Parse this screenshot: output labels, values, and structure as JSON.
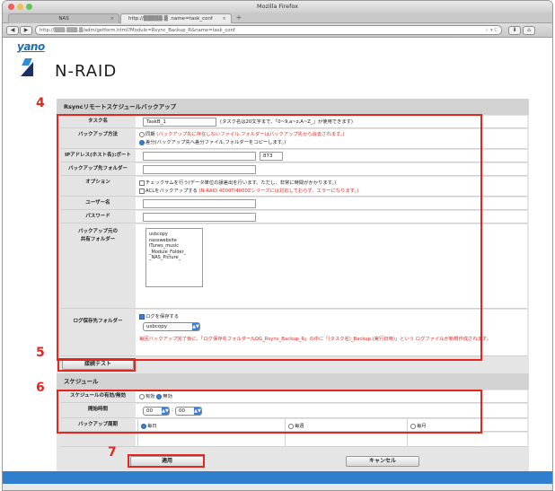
{
  "browser": {
    "window_title": "Mozilla Firefox",
    "tabs": [
      {
        "label": "NAS",
        "close": "×"
      },
      {
        "label": "http://▒▒▒▒▒.▒ .name=task_conf",
        "close": "×"
      }
    ],
    "new_tab": "+",
    "back": "◀",
    "forward": "▶",
    "url": "http://▒▒▒.▒▒▒.▒/adm/getform.html?Module=Rsync_Backup_R&name=task_conf",
    "url_right": "☆ ▾ C",
    "btn_download": "⬇",
    "btn_home": "⌂"
  },
  "logo": {
    "brand": "yano",
    "product": "N-RAID"
  },
  "section1": {
    "title": "Rsyncリモートスケジュールバックアップ",
    "task_name_label": "タスク名",
    "task_name_value": "TaskB_1",
    "task_name_hint": "(タスク名は20文字まで、「0~9,a~z,A~Z_」が使用できます)",
    "method_label": "バックアップ方法",
    "method_opt1": "同期",
    "method_opt1_note": "(バックアップ先に存在しないファイル,フォルダーはバックアップ先から消去されます。)",
    "method_opt2": "差分(バックアップ先へ差分ファイル,フォルダーをコピーします。)",
    "ip_label": "IPアドレス(ホスト名):ポート",
    "ip_port_value": "873",
    "dest_label": "バックアップ先フォルダー",
    "option_label": "オプション",
    "opt1": "チェックサムを行う(データ単位の誤差出を行います。ただし、非常に時間がかかります。)",
    "opt2": "ACLをバックアップする",
    "opt2_note": "(N-RAID 4000T/4000Zシリーズには対応しておらず、エラーになります。)",
    "user_label": "ユーザー名",
    "pass_label": "パスワード",
    "share_label": "バックアップ元の\n共有フォルダー",
    "share_items": [
      "usbcopy",
      "nasswebsite",
      "iTunes_music",
      "_Module_Folder_",
      "_NAS_Picture_"
    ],
    "log_label": "ログ保存先フォルダー",
    "log_check": "ログを保存する",
    "log_select": "usbcopy",
    "log_note": "毎回バックアップ完了後に、「ログ保存先フォルダー/LOG_Rsync_Backup_R」の中に「(タスク名)_Backup.(実行日時)」という ログファイルが新規作成されます。"
  },
  "connect_test": "接続テスト",
  "section2": {
    "title": "スケジュール",
    "enable_label": "スケジュールの有効/無効",
    "enable_on": "有効",
    "enable_off": "無効",
    "start_label": "開始時間",
    "hour": "00",
    "minute": "00",
    "cycle_label": "バックアップ周期",
    "cycle_daily": "毎日",
    "cycle_weekly": "毎週",
    "cycle_monthly": "毎月"
  },
  "apply": "適用",
  "cancel": "キャンセル",
  "callouts": [
    "4",
    "5",
    "6",
    "7"
  ],
  "colors": {
    "accent": "#e4261f",
    "brand": "#1e6fb5"
  }
}
